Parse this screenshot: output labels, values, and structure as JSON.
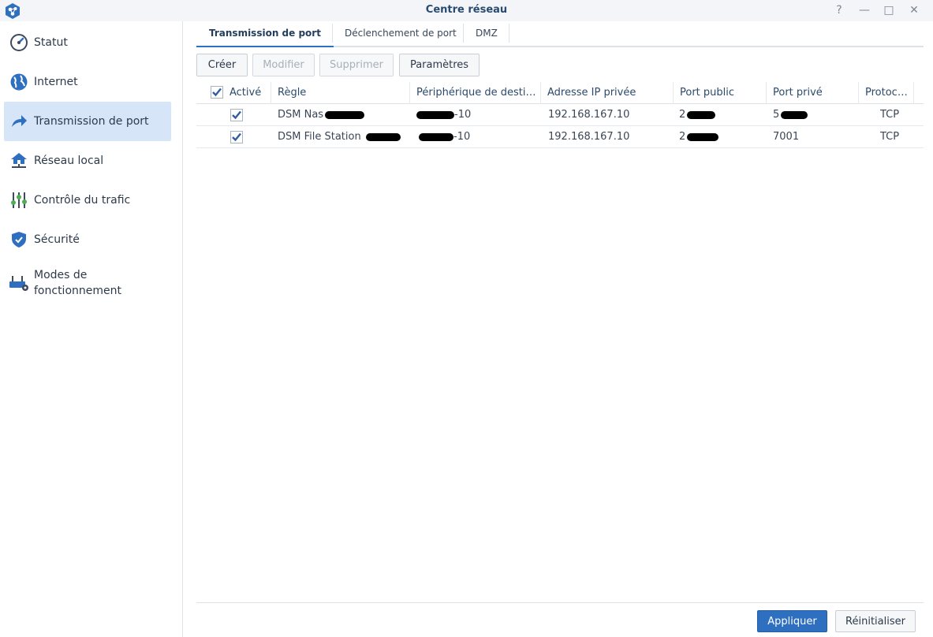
{
  "window": {
    "title": "Centre réseau",
    "help": "?",
    "minimize": "—",
    "maximize": "□",
    "close": "✕"
  },
  "sidebar": {
    "items": [
      {
        "label": "Statut",
        "icon": "gauge-icon"
      },
      {
        "label": "Internet",
        "icon": "globe-icon"
      },
      {
        "label": "Transmission de port",
        "icon": "share-arrow-icon",
        "active": true
      },
      {
        "label": "Réseau local",
        "icon": "house-network-icon"
      },
      {
        "label": "Contrôle du trafic",
        "icon": "sliders-icon"
      },
      {
        "label": "Sécurité",
        "icon": "shield-icon"
      },
      {
        "label": "Modes de fonctionnement",
        "icon": "router-gear-icon"
      }
    ]
  },
  "tabs": [
    {
      "label": "Transmission de port",
      "active": true
    },
    {
      "label": "Déclenchement de port"
    },
    {
      "label": "DMZ"
    }
  ],
  "toolbar": {
    "create": "Créer",
    "modify": "Modifier",
    "delete": "Supprimer",
    "settings": "Paramètres"
  },
  "table": {
    "columns": [
      "Activé",
      "Règle",
      "Périphérique de desti…",
      "Adresse IP privée",
      "Port public",
      "Port privé",
      "Protoc…"
    ],
    "rows": [
      {
        "enabled": true,
        "rule": "DSM Nas",
        "device_suffix": "-10",
        "ip": "192.168.167.10",
        "public_port": "2",
        "private_port": "5",
        "protocol": "TCP"
      },
      {
        "enabled": true,
        "rule": "DSM File Station",
        "device_suffix": "-10",
        "ip": "192.168.167.10",
        "public_port": "2",
        "private_port": "7001",
        "protocol": "TCP"
      }
    ]
  },
  "footer": {
    "apply": "Appliquer",
    "reset": "Réinitialiser"
  },
  "colors": {
    "accent": "#2f6fc0",
    "active_bg": "#d6e6f8",
    "check": "#2f5f9e"
  }
}
